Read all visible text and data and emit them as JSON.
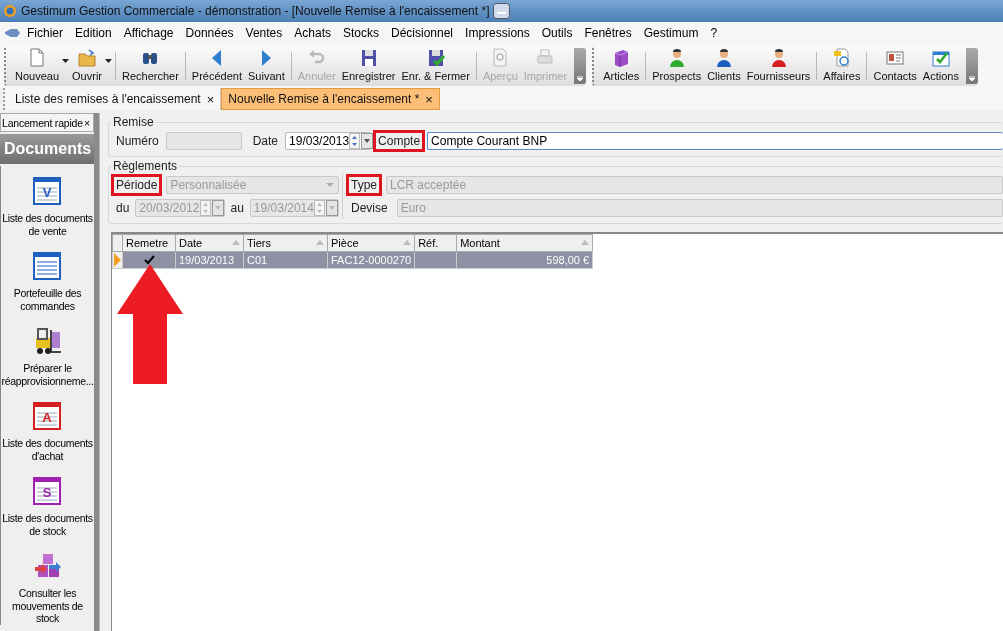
{
  "window": {
    "title": "Gestimum Gestion Commerciale - démonstration - [Nouvelle Remise à l'encaissement *]"
  },
  "menu": [
    "Fichier",
    "Edition",
    "Affichage",
    "Données",
    "Ventes",
    "Achats",
    "Stocks",
    "Décisionnel",
    "Impressions",
    "Outils",
    "Fenêtres",
    "Gestimum",
    "?"
  ],
  "toolbars": [
    {
      "items": [
        {
          "label": "Nouveau",
          "kind": "new",
          "disabled": false,
          "dropdown": true
        },
        {
          "label": "Ouvrir",
          "kind": "open",
          "disabled": false,
          "dropdown": true
        },
        {
          "label": "Rechercher",
          "kind": "search",
          "disabled": false,
          "sep": true
        },
        {
          "label": "Précédent",
          "kind": "prev",
          "disabled": false,
          "sep": true
        },
        {
          "label": "Suivant",
          "kind": "next",
          "disabled": false
        },
        {
          "label": "Annuler",
          "kind": "undo",
          "disabled": true,
          "sep": true
        },
        {
          "label": "Enregistrer",
          "kind": "save",
          "disabled": false
        },
        {
          "label": "Enr. & Fermer",
          "kind": "save-close",
          "disabled": false
        },
        {
          "label": "Aperçu",
          "kind": "preview",
          "disabled": true,
          "sep": true
        },
        {
          "label": "Imprimer",
          "kind": "print",
          "disabled": true
        }
      ]
    },
    {
      "items": [
        {
          "label": "Articles",
          "kind": "cube",
          "disabled": false
        },
        {
          "label": "Prospects",
          "kind": "person",
          "color": "#2eaa2e",
          "disabled": false,
          "sep": true
        },
        {
          "label": "Clients",
          "kind": "person",
          "color": "#1f5fbf",
          "disabled": false
        },
        {
          "label": "Fournisseurs",
          "kind": "person",
          "color": "#d42020",
          "disabled": false
        },
        {
          "label": "Affaires",
          "kind": "folder-clock",
          "disabled": false,
          "sep": true
        },
        {
          "label": "Contacts",
          "kind": "card",
          "disabled": false,
          "sep": true
        },
        {
          "label": "Actions",
          "kind": "calendar-check",
          "disabled": false
        }
      ]
    }
  ],
  "tabs": [
    {
      "label": "Liste des remises à l'encaissement",
      "close": "×",
      "selected": false
    },
    {
      "label": "Nouvelle Remise à l'encaissement *",
      "close": "×",
      "selected": true
    }
  ],
  "sidebar": {
    "title": "Lancement rapide",
    "close": "×",
    "heading": "Documents",
    "items": [
      {
        "lines": [
          "Liste des documents",
          "de vente"
        ],
        "kind": "document",
        "letter": "V",
        "color": "#1f5fbf"
      },
      {
        "lines": [
          "Portefeuille des",
          "commandes"
        ],
        "kind": "list"
      },
      {
        "lines": [
          "Préparer le",
          "réapprovisionneme..."
        ],
        "kind": "forklift"
      },
      {
        "lines": [
          "Liste des documents",
          "d'achat"
        ],
        "kind": "document",
        "letter": "A",
        "color": "#d42020"
      },
      {
        "lines": [
          "Liste des documents",
          "de stock"
        ],
        "kind": "document",
        "letter": "S",
        "color": "#a020b0"
      },
      {
        "lines": [
          "Consulter les",
          "mouvements de",
          "stock"
        ],
        "kind": "cubes-arrows"
      }
    ]
  },
  "remise": {
    "legend": "Remise",
    "numero": {
      "label": "Numéro",
      "disabled": true
    },
    "date": {
      "label": "Date",
      "value": "19/03/2013"
    },
    "compte": {
      "label": "Compte",
      "value": "Compte Courant BNP",
      "highlighted": true
    }
  },
  "reglements": {
    "legend": "Règlements",
    "periode": {
      "label": "Période",
      "value": "Personnalisée",
      "highlighted": true,
      "disabled": true
    },
    "type": {
      "label": "Type",
      "value": "LCR acceptée",
      "highlighted": true,
      "disabled": true
    },
    "du": {
      "label": "du",
      "value": "20/03/2012",
      "disabled": true
    },
    "au": {
      "label": "au",
      "value": "19/03/2014",
      "disabled": true
    },
    "devise": {
      "label": "Devise",
      "value": "Euro",
      "disabled": true
    }
  },
  "table": {
    "columns": [
      {
        "label": "Remetre"
      },
      {
        "label": "Date",
        "sort": true
      },
      {
        "label": "Tiers",
        "sort": true
      },
      {
        "label": "Pièce",
        "sort": true
      },
      {
        "label": "Réf."
      },
      {
        "label": "Montant",
        "sort": true
      }
    ],
    "rows": [
      {
        "selected": true,
        "remettre": true,
        "date": "19/03/2013",
        "tiers": "C01",
        "piece": "FAC12-0000270",
        "montant": "598,00 €"
      }
    ]
  }
}
